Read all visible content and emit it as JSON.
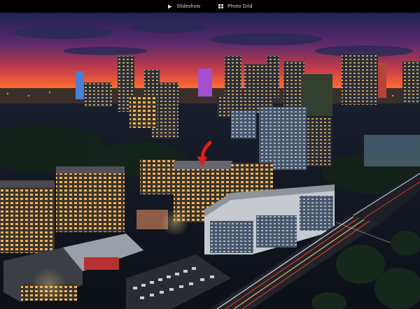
{
  "toolbar": {
    "slideshow_label": "Slideshow",
    "photo_grid_label": "Photo Grid"
  },
  "photo": {
    "subject": "Aerial night skyline with apartment buildings and highway"
  },
  "icons": {
    "slideshow": "play-icon",
    "photo_grid": "grid-icon",
    "marker": "red-arrow-marker-icon"
  },
  "colors": {
    "bar_bg": "#000000",
    "bar_text": "#d9d9d9",
    "sky_top": "#22285a",
    "sky_glow": "#ff5a2a",
    "marker": "#e01e1e"
  }
}
